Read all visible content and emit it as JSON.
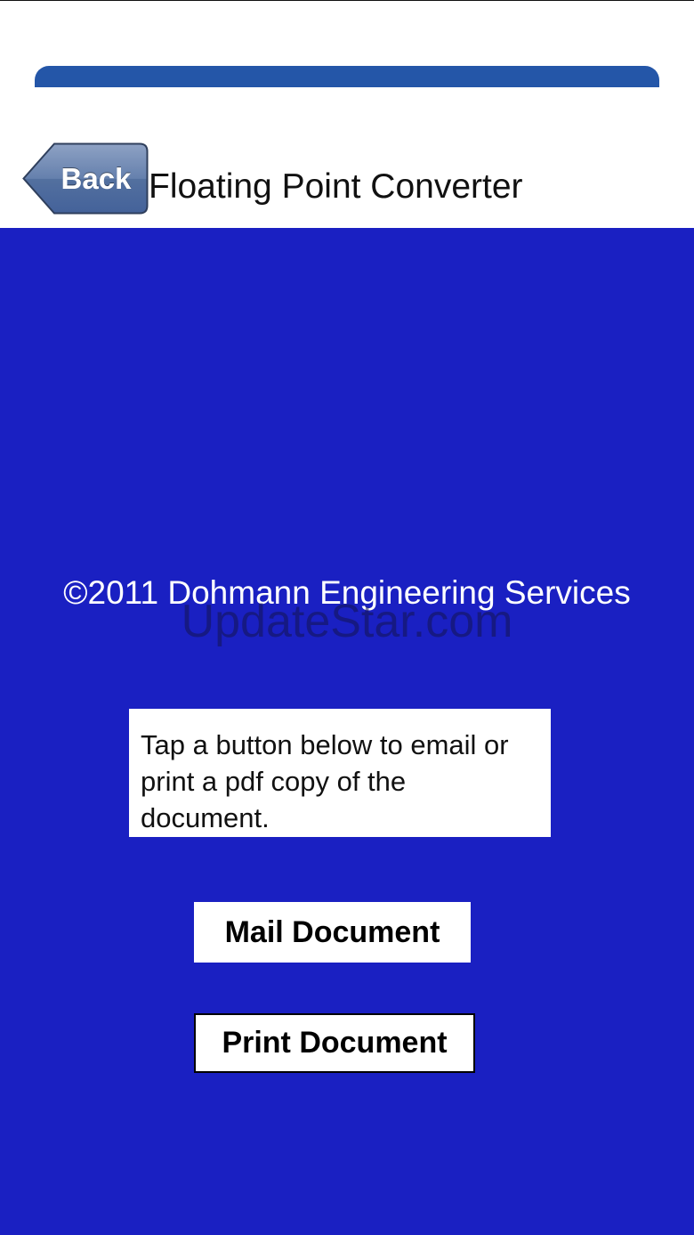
{
  "header": {
    "back_label": "Back",
    "title": "Floating Point Converter",
    "bar_color": "#2456a8"
  },
  "main": {
    "background_color": "#1a20c2",
    "copyright": "©2011 Dohmann Engineering Services",
    "watermark": "UpdateStar.com",
    "instructions": "Tap a button below to email or print a pdf copy of the document.",
    "mail_button_label": "Mail Document",
    "print_button_label": "Print Document"
  }
}
